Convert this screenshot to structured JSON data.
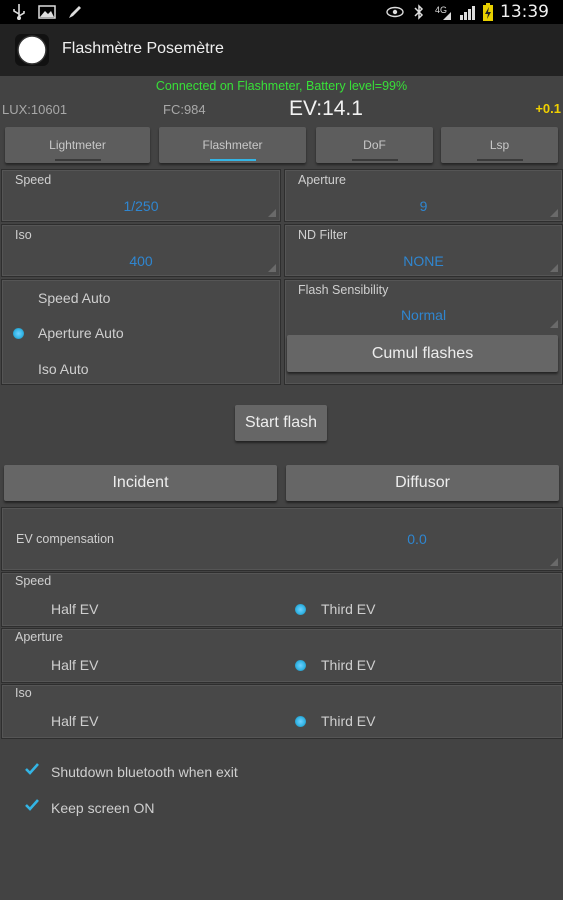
{
  "status_bar": {
    "time": "13:39",
    "icons_left": [
      "usb-icon",
      "image-icon",
      "pen-icon"
    ],
    "icons_right": [
      "eye-icon",
      "bluetooth-icon",
      "signal-4g-icon",
      "signal-bars-icon",
      "battery-charging-icon"
    ],
    "signal_label": "4G"
  },
  "app": {
    "title": "Flashmètre Posemètre",
    "accent": "#33b5e5"
  },
  "info": {
    "connection": "Connected on Flashmeter, Battery level=99%",
    "lux": "LUX:10601",
    "fc": "FC:984",
    "ev": "EV:14.1",
    "ev_correction": "+0.1"
  },
  "tabs": [
    {
      "label": "Lightmeter",
      "active": false
    },
    {
      "label": "Flashmeter",
      "active": true
    },
    {
      "label": "DoF",
      "active": false
    },
    {
      "label": "Lsp",
      "active": false
    }
  ],
  "settings": {
    "speed": {
      "label": "Speed",
      "value": "1/250"
    },
    "aperture": {
      "label": "Aperture",
      "value": "9"
    },
    "iso": {
      "label": "Iso",
      "value": "400"
    },
    "nd_filter": {
      "label": "ND Filter",
      "value": "NONE"
    },
    "flash_sensibility": {
      "label": "Flash Sensibility",
      "value": "Normal"
    }
  },
  "auto_modes": [
    {
      "label": "Speed Auto",
      "selected": false
    },
    {
      "label": "Aperture Auto",
      "selected": true
    },
    {
      "label": "Iso Auto",
      "selected": false
    }
  ],
  "buttons": {
    "cumul_flashes": "Cumul flashes",
    "start_flash": "Start flash",
    "incident": "Incident",
    "diffusor": "Diffusor"
  },
  "ev_compensation": {
    "label": "EV compensation",
    "value": "0.0"
  },
  "steps": [
    {
      "group": "Speed",
      "options": [
        "Half EV",
        "Third EV"
      ],
      "selected": "Third EV"
    },
    {
      "group": "Aperture",
      "options": [
        "Half EV",
        "Third EV"
      ],
      "selected": "Third EV"
    },
    {
      "group": "Iso",
      "options": [
        "Half EV",
        "Third EV"
      ],
      "selected": "Third EV"
    }
  ],
  "checkboxes": [
    {
      "label": "Shutdown bluetooth when exit",
      "checked": true
    },
    {
      "label": "Keep screen ON",
      "checked": true
    }
  ]
}
